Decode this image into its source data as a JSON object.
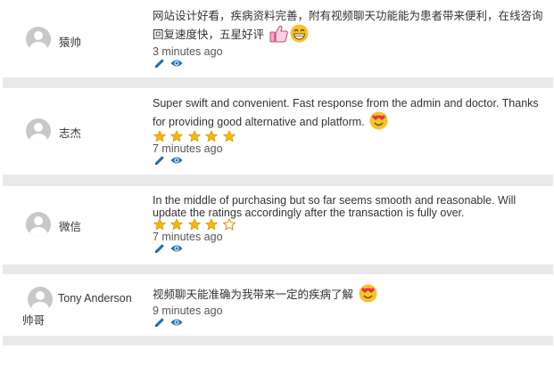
{
  "reviews": [
    {
      "author": "猿帅",
      "text": "网站设计好看，疾病资料完善，附有视频聊天功能能为患者带来便利，在线咨询回复速度快，五星好评",
      "emojis": [
        "thumbs-up-icon",
        "grinning-face-icon"
      ],
      "rating": null,
      "time": "3 minutes ago"
    },
    {
      "author": "志杰",
      "text": "Super swift and convenient. Fast response from the admin and doctor. Thanks for providing good alternative and platform.",
      "emojis": [
        "heart-eyes-face-icon"
      ],
      "rating": 5,
      "time": "7 minutes ago"
    },
    {
      "author": "微信",
      "text": "In the middle of purchasing but so far seems smooth and reasonable. Will update the ratings accordingly after the transaction is fully over.",
      "emojis": [],
      "rating": 4,
      "time": "7 minutes ago"
    },
    {
      "author": "Tony Anderson",
      "author_line2": "帅哥",
      "text": "视频聊天能准确为我带来一定的疾病了解",
      "emojis": [
        "heart-eyes-face-icon"
      ],
      "rating": null,
      "time": "9 minutes ago"
    }
  ],
  "icons": {
    "edit": "pencil-icon",
    "view": "eye-icon"
  },
  "colors": {
    "separator": "#e9e9e9",
    "star_fill": "#f5b800",
    "icon_blue": "#1f6fb2",
    "emoji_yellow": "#f7c325"
  }
}
